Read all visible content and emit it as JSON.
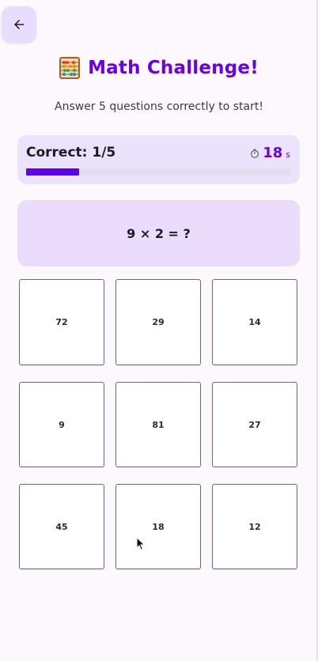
{
  "header": {
    "back_icon": "arrow-left-icon",
    "title_icon": "abacus-icon",
    "title": "Math Challenge!",
    "subtitle": "Answer 5 questions correctly to start!"
  },
  "progress": {
    "correct_label": "Correct: 1/5",
    "correct": 1,
    "total": 5,
    "fraction": 0.2,
    "timer_icon": "stopwatch-icon",
    "timer_value": "18",
    "timer_unit": "s"
  },
  "question": {
    "text": "9 × 2 = ?"
  },
  "answers": [
    "72",
    "29",
    "14",
    "9",
    "81",
    "27",
    "45",
    "18",
    "12"
  ],
  "colors": {
    "accent": "#6a00e6",
    "progress_fill": "#6200ee",
    "card_bg": "#ebe2fb",
    "background": "#fdf8fd"
  }
}
